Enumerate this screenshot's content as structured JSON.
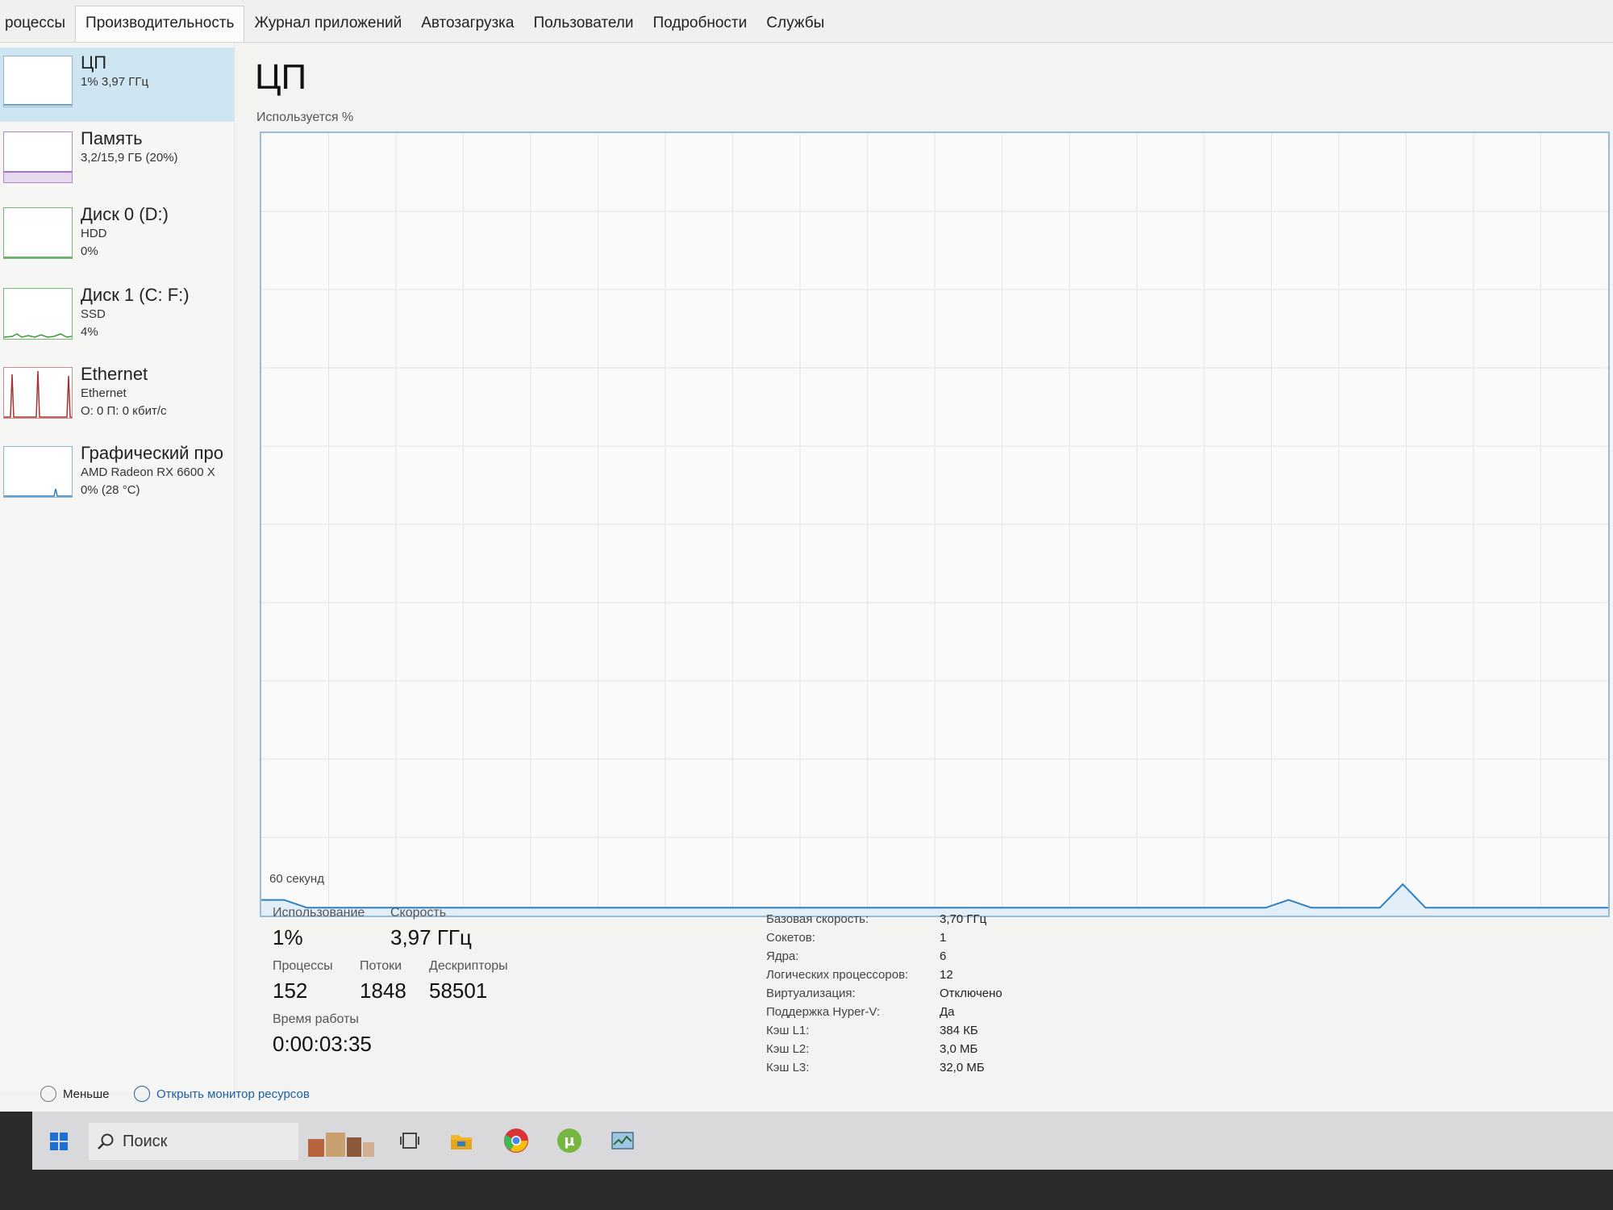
{
  "tabs": [
    "роцессы",
    "Производительность",
    "Журнал приложений",
    "Автозагрузка",
    "Пользователи",
    "Подробности",
    "Службы"
  ],
  "sidebar": {
    "items": [
      {
        "name": "ЦП",
        "sub1": "1% 3,97 ГГц",
        "sub2": "",
        "sub3": "",
        "selected": true
      },
      {
        "name": "Память",
        "sub1": "3,2/15,9 ГБ (20%)",
        "sub2": "",
        "sub3": ""
      },
      {
        "name": "Диск 0 (D:)",
        "sub1": "HDD",
        "sub2": "0%",
        "sub3": ""
      },
      {
        "name": "Диск 1 (C: F:)",
        "sub1": "SSD",
        "sub2": "4%",
        "sub3": ""
      },
      {
        "name": "Ethernet",
        "sub1": "Ethernet",
        "sub2": "О: 0 П: 0 кбит/с",
        "sub3": ""
      },
      {
        "name": "Графический про",
        "sub1": "AMD Radeon RX 6600 X",
        "sub2": "0% (28 °C)",
        "sub3": ""
      }
    ]
  },
  "main": {
    "title": "ЦП",
    "utilization_label": "Используется %",
    "time_label": "60 секунд",
    "stats": {
      "usage_label": "Использование",
      "usage_value": "1%",
      "speed_label": "Скорость",
      "speed_value": "3,97 ГГц",
      "processes_label": "Процессы",
      "processes_value": "152",
      "threads_label": "Потоки",
      "threads_value": "1848",
      "handles_label": "Дескрипторы",
      "handles_value": "58501",
      "uptime_label": "Время работы",
      "uptime_value": "0:00:03:35"
    },
    "specs": [
      {
        "label": "Базовая скорость:",
        "value": "3,70 ГГц"
      },
      {
        "label": "Сокетов:",
        "value": "1"
      },
      {
        "label": "Ядра:",
        "value": "6"
      },
      {
        "label": "Логических процессоров:",
        "value": "12"
      },
      {
        "label": "Виртуализация:",
        "value": "Отключено"
      },
      {
        "label": "Поддержка Hyper-V:",
        "value": "Да"
      },
      {
        "label": "Кэш L1:",
        "value": "384 КБ"
      },
      {
        "label": "Кэш L2:",
        "value": "3,0 МБ"
      },
      {
        "label": "Кэш L3:",
        "value": "32,0 МБ"
      }
    ],
    "cpu_history_percent": [
      2,
      2,
      1,
      1,
      1,
      1,
      1,
      1,
      1,
      1,
      1,
      1,
      1,
      1,
      1,
      1,
      1,
      1,
      1,
      1,
      1,
      1,
      1,
      1,
      1,
      1,
      1,
      1,
      1,
      1,
      1,
      1,
      1,
      1,
      1,
      1,
      1,
      1,
      1,
      1,
      1,
      1,
      1,
      1,
      1,
      2,
      1,
      1,
      1,
      1,
      4,
      1,
      1,
      1,
      1,
      1,
      1,
      1,
      1,
      1
    ]
  },
  "footer": {
    "less_label": "Меньше",
    "resmon_label": "Открыть монитор ресурсов"
  },
  "taskbar": {
    "search_placeholder": "Поиск"
  },
  "colors": {
    "accent": "#2e7fc0",
    "selected_bg": "#cfe6f2",
    "ethernet": "#a83232",
    "disk": "#3a9a3a"
  }
}
